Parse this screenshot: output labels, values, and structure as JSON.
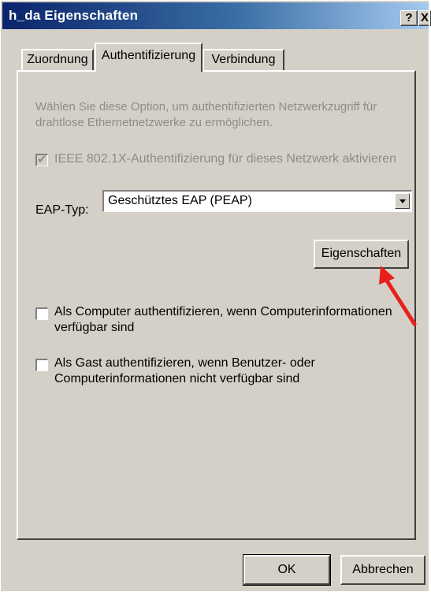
{
  "window": {
    "title": "h_da Eigenschaften",
    "help_label": "?",
    "close_label": "X"
  },
  "tabs": [
    {
      "label": "Zuordnung"
    },
    {
      "label": "Authentifizierung"
    },
    {
      "label": "Verbindung"
    }
  ],
  "authentication": {
    "description": "Wählen Sie diese Option, um authentifizierten Netzwerkzugriff für drahtlose Ethernetnetzwerke zu ermöglichen.",
    "ieee_checkbox_label": "IEEE 802.1X-Authentifizierung für dieses Netzwerk aktivieren",
    "ieee_checked": true,
    "eap_label": "EAP-Typ:",
    "eap_value": "Geschütztes EAP (PEAP)",
    "properties_button": "Eigenschaften",
    "computer_checkbox_label": "Als Computer authentifizieren, wenn Computerinformationen verfügbar sind",
    "guest_checkbox_label": "Als Gast authentifizieren, wenn Benutzer- oder Computerinformationen nicht verfügbar sind"
  },
  "footer": {
    "ok_label": "OK",
    "cancel_label": "Abbrechen"
  },
  "colors": {
    "annotation_arrow": "#e8201a",
    "titlebar_start": "#0a246a"
  }
}
